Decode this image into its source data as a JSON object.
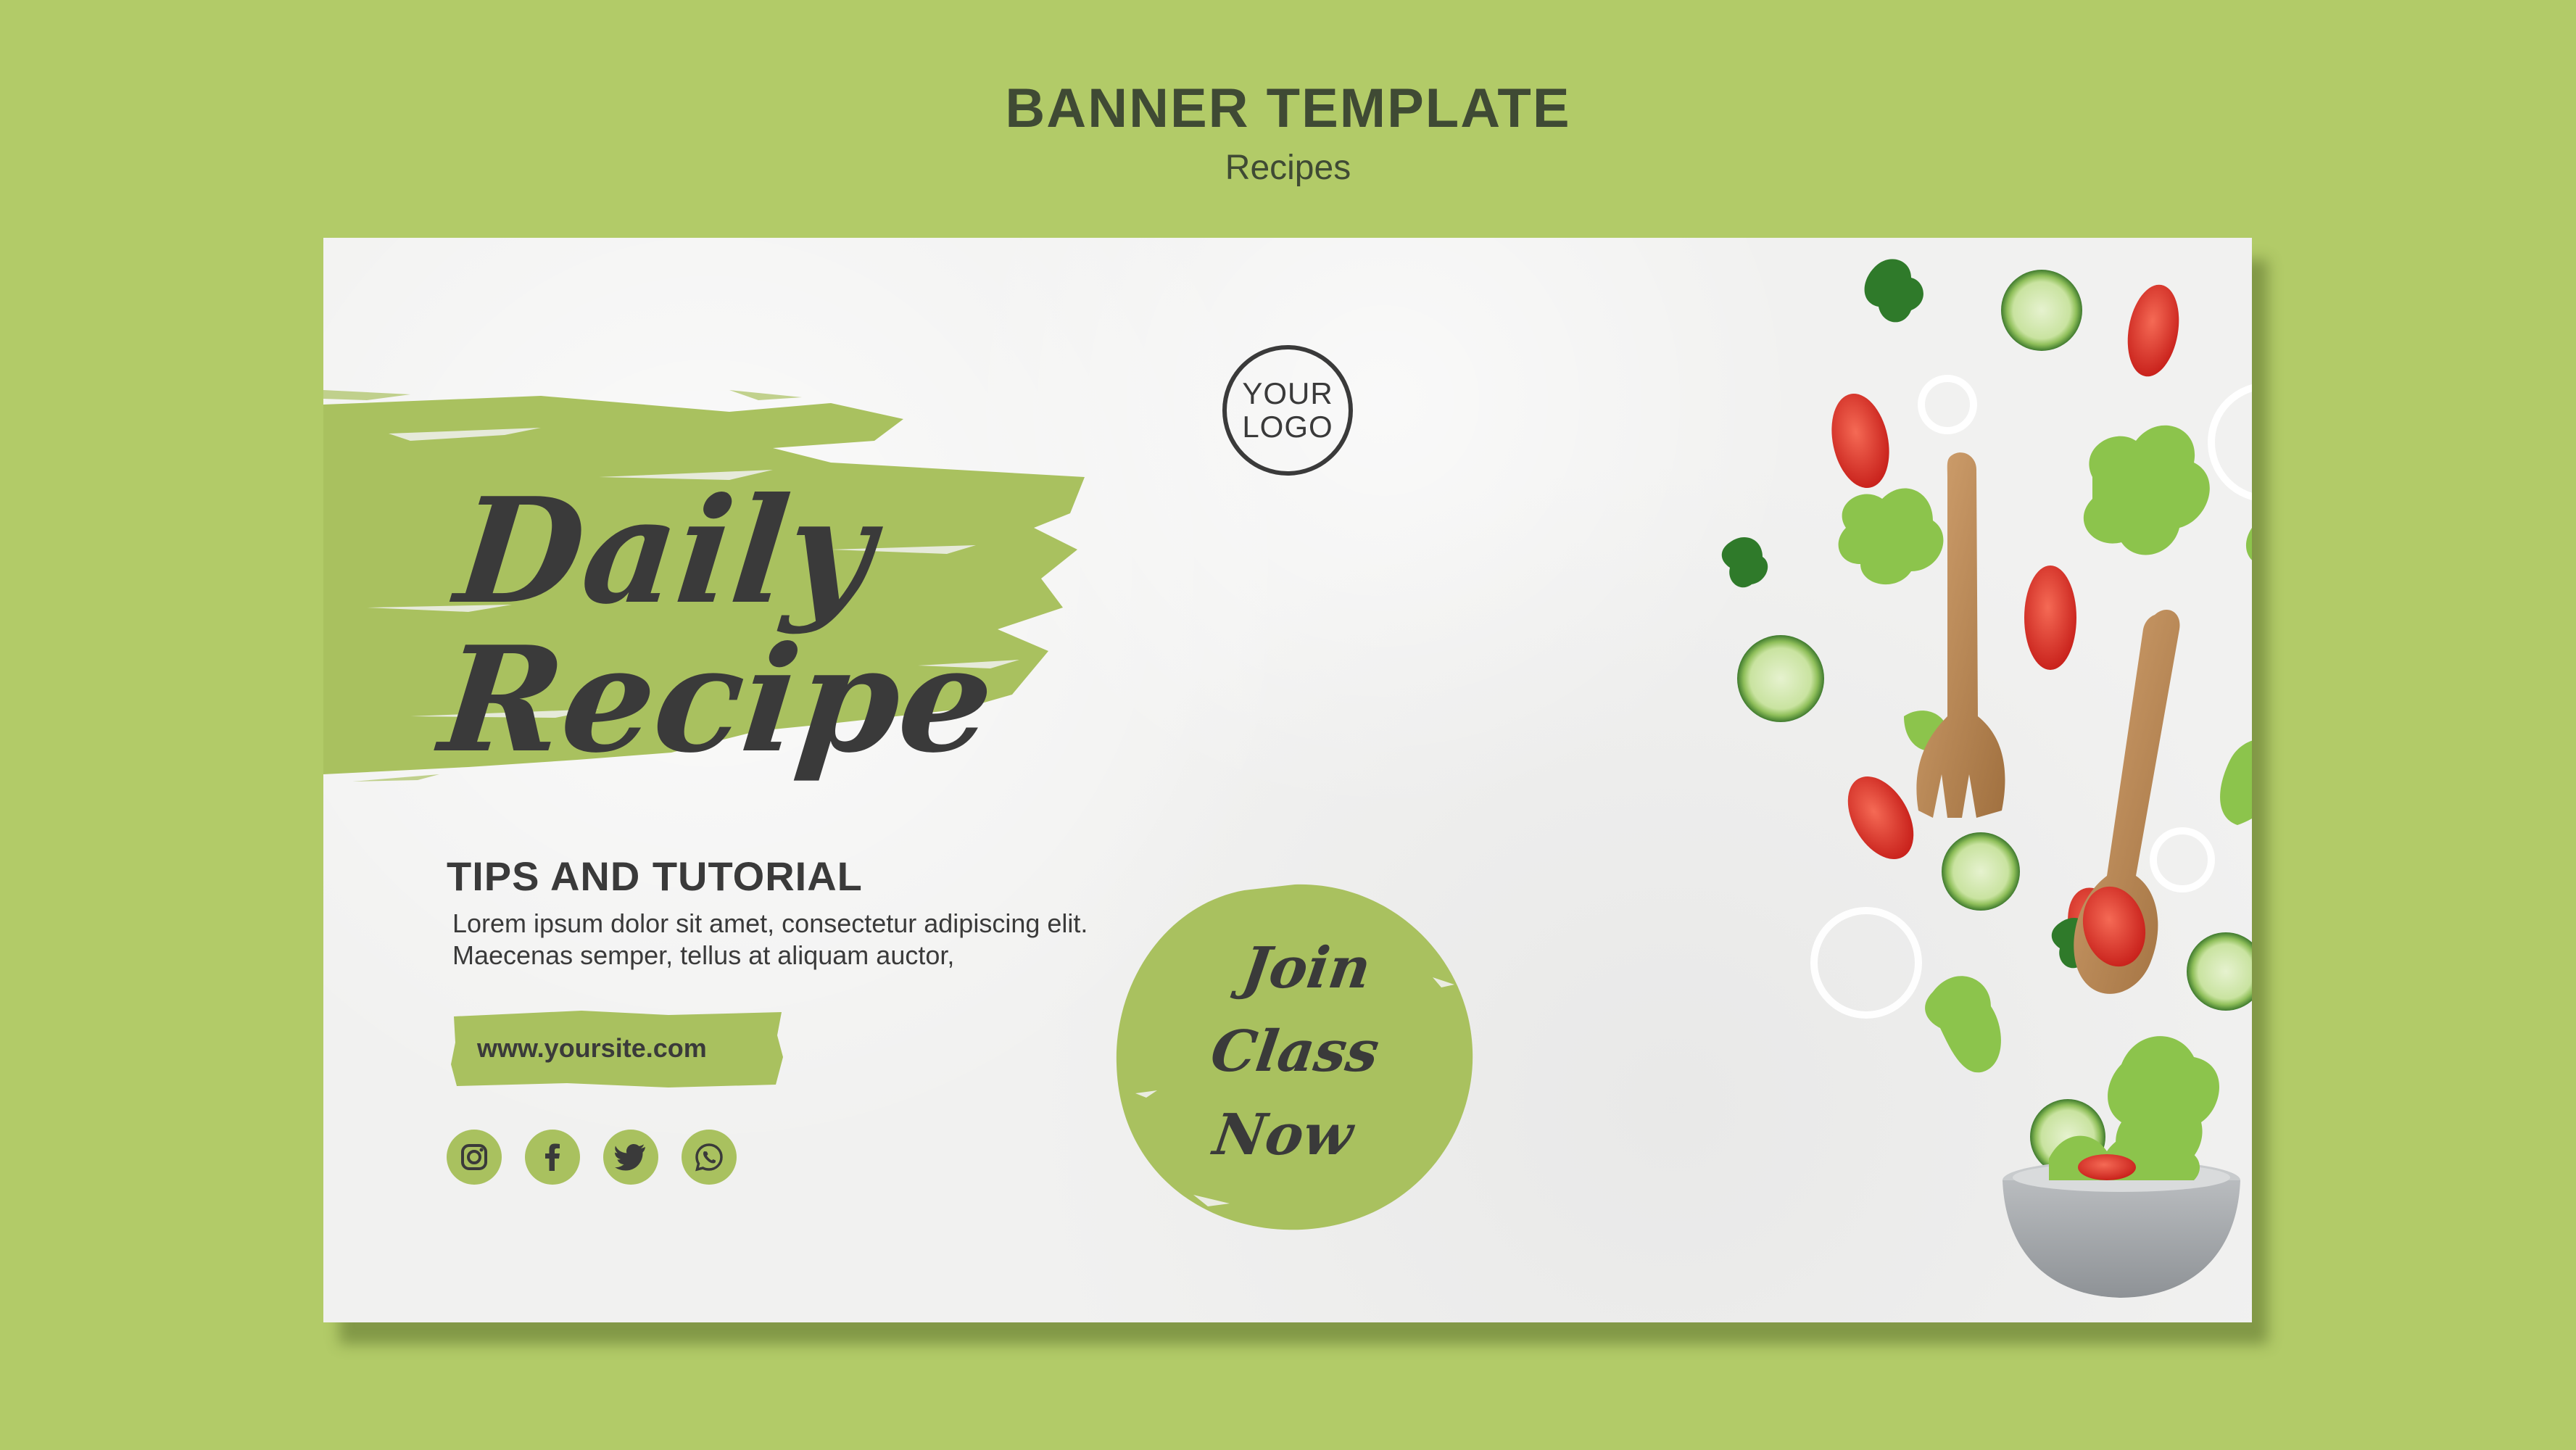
{
  "header": {
    "title": "BANNER TEMPLATE",
    "subtitle": "Recipes"
  },
  "banner": {
    "headline": [
      "Daily",
      "Recipe"
    ],
    "logo": [
      "YOUR",
      "LOGO"
    ],
    "tips_title": "TIPS AND TUTORIAL",
    "tips_body": "Lorem ipsum dolor sit amet, consectetur adipiscing elit. Maecenas semper, tellus at aliquam auctor,",
    "website": "www.yoursite.com",
    "cta": [
      "Join",
      "Class",
      "Now"
    ],
    "socials": [
      "instagram-icon",
      "facebook-icon",
      "twitter-icon",
      "whatsapp-icon"
    ]
  },
  "colors": {
    "background": "#b2cb68",
    "accent": "#a9c15f",
    "text": "#3a3a3a",
    "banner": "#f1f1f0"
  }
}
